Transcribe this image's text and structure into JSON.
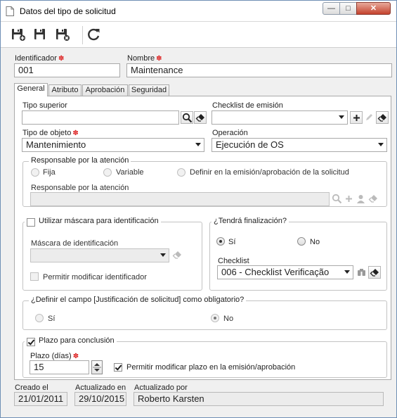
{
  "window": {
    "title": "Datos del tipo de solicitud",
    "controls": {
      "minimize": "—",
      "maximize": "□",
      "close": "✕"
    }
  },
  "toolbar": {
    "buttons": [
      {
        "name": "save-new-button",
        "icon": "save-new-icon"
      },
      {
        "name": "save-button",
        "icon": "save-icon"
      },
      {
        "name": "save-close-button",
        "icon": "save-close-icon"
      },
      {
        "name": "refresh-button",
        "icon": "refresh-icon"
      }
    ]
  },
  "header": {
    "identificador_label": "Identificador",
    "identificador_value": "001",
    "nombre_label": "Nombre",
    "nombre_value": "Maintenance",
    "required_mark": "✽"
  },
  "tabs": [
    "General",
    "Atributo",
    "Aprobación",
    "Seguridad"
  ],
  "general": {
    "tipo_superior_label": "Tipo superior",
    "tipo_superior_value": "",
    "checklist_emision_label": "Checklist de emisión",
    "checklist_emision_value": "",
    "tipo_objeto_label": "Tipo de objeto",
    "tipo_objeto_value": "Mantenimiento",
    "operacion_label": "Operación",
    "operacion_value": "Ejecución de OS",
    "responsable_group": {
      "legend": "Responsable por la atención",
      "options": [
        "Fija",
        "Variable",
        "Definir en la emisión/aprobación de la solicitud"
      ],
      "field_label": "Responsable por la atención",
      "field_value": ""
    },
    "mascara_group": {
      "legend": "Utilizar máscara para identificación",
      "checked": false,
      "field_label": "Máscara de identificación",
      "field_value": "",
      "permitir_label": "Permitir modificar identificador",
      "permitir_checked": false
    },
    "finalizacion_group": {
      "legend": "¿Tendrá finalización?",
      "options": [
        "Sí",
        "No"
      ],
      "selected": "Sí",
      "checklist_label": "Checklist",
      "checklist_value": "006 - Checklist Verificação"
    },
    "justificacion_group": {
      "legend": "¿Definir el campo [Justificación de solicitud] como obligatorio?",
      "options": [
        "Sí",
        "No"
      ],
      "selected": "No"
    },
    "plazo_group": {
      "legend": "Plazo para conclusión",
      "checked": true,
      "plazo_label": "Plazo (días)",
      "plazo_value": "15",
      "permitir_label": "Permitir modificar plazo en la emisión/aprobación",
      "permitir_checked": true
    }
  },
  "footer": {
    "creado_label": "Creado el",
    "creado_value": "21/01/2011",
    "actualizado_label": "Actualizado en",
    "actualizado_value": "29/10/2015",
    "actualizado_por_label": "Actualizado por",
    "actualizado_por_value": "Roberto Karsten"
  },
  "colors": {
    "window_border": "#6f8fb5",
    "close_button": "#c4422d",
    "required_mark": "#dd2222"
  }
}
